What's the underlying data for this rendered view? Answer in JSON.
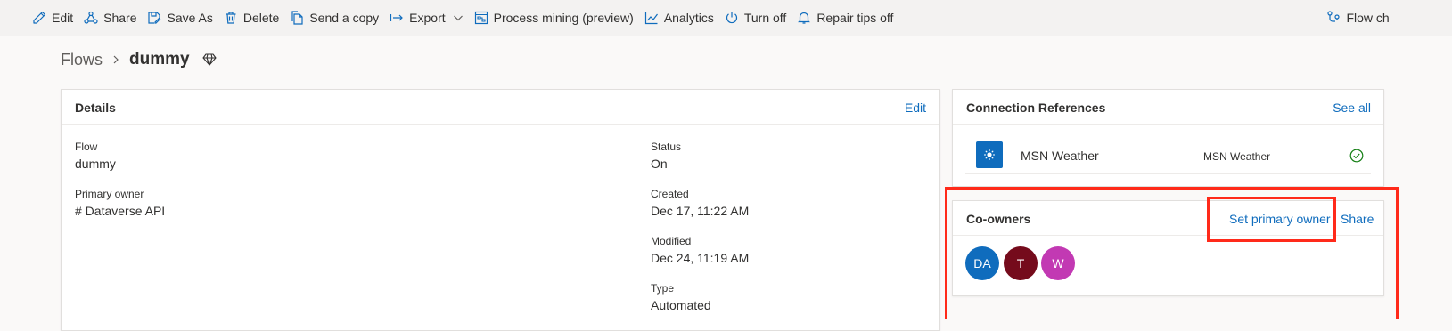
{
  "toolbar": {
    "items": [
      {
        "label": "Edit",
        "icon": "pencil-icon"
      },
      {
        "label": "Share",
        "icon": "share-icon"
      },
      {
        "label": "Save As",
        "icon": "save-as-icon"
      },
      {
        "label": "Delete",
        "icon": "trash-icon"
      },
      {
        "label": "Send a copy",
        "icon": "copy-icon"
      },
      {
        "label": "Export",
        "icon": "export-arrow-icon"
      },
      {
        "label": "Process mining (preview)",
        "icon": "process-mining-icon"
      },
      {
        "label": "Analytics",
        "icon": "chart-line-icon"
      },
      {
        "label": "Turn off",
        "icon": "power-icon"
      },
      {
        "label": "Repair tips off",
        "icon": "bell-icon"
      },
      {
        "label": "Flow ch",
        "icon": "flow-checker-icon"
      }
    ]
  },
  "breadcrumb": {
    "parent": "Flows",
    "current": "dummy"
  },
  "details": {
    "title": "Details",
    "edit_label": "Edit",
    "fields": {
      "flow": {
        "label": "Flow",
        "value": "dummy"
      },
      "primary_owner": {
        "label": "Primary owner",
        "value": "# Dataverse API"
      },
      "status": {
        "label": "Status",
        "value": "On"
      },
      "created": {
        "label": "Created",
        "value": "Dec 17, 11:22 AM"
      },
      "modified": {
        "label": "Modified",
        "value": "Dec 24, 11:19 AM"
      },
      "type": {
        "label": "Type",
        "value": "Automated"
      }
    }
  },
  "connections": {
    "title": "Connection References",
    "see_all_label": "See all",
    "items": [
      {
        "name": "MSN Weather",
        "connector": "MSN Weather",
        "status": "connected",
        "icon": "sun-icon"
      }
    ]
  },
  "coowners": {
    "title": "Co-owners",
    "set_primary_label": "Set primary owner",
    "share_label": "Share",
    "avatars": [
      {
        "initials": "DA",
        "color": "#0f6cbd"
      },
      {
        "initials": "T",
        "color": "#750b1c"
      },
      {
        "initials": "W",
        "color": "#c239b3"
      }
    ]
  },
  "colors": {
    "accent": "#0f6cbd",
    "success": "#107c10",
    "highlight": "#ff2a1a"
  }
}
